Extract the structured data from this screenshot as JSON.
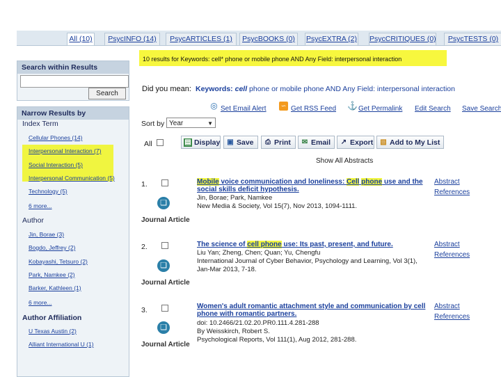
{
  "tabs": [
    {
      "label": "All (10)",
      "active": true
    },
    {
      "label": "PsycINFO (14)",
      "active": false
    },
    {
      "label": "PsycARTICLES (1)",
      "active": false
    },
    {
      "label": "PsycBOOKS (0)",
      "active": false
    },
    {
      "label": "PsycEXTRA (2)",
      "active": false
    },
    {
      "label": "PsycCRITIQUES (0)",
      "active": false
    },
    {
      "label": "PsycTESTS (0)",
      "active": false
    }
  ],
  "search_within": {
    "title": "Search within Results",
    "button": "Search",
    "value": ""
  },
  "narrow": {
    "title": "Narrow Results by",
    "index_term": {
      "title": "Index Term",
      "items": [
        "Cellular Phones (14)",
        "Interpersonal Interaction (7)",
        "Social Interaction (5)",
        "Interpersonal Communication (5)",
        "Technology (5)",
        "6 more..."
      ]
    },
    "author": {
      "title": "Author",
      "items": [
        "Jin, Borae (3)",
        "Bogdo, Jeffrey (2)",
        "Kobayashi, Tetsuro (2)",
        "Park, Namkee (2)",
        "Barker, Kathleen (1)",
        "6 more..."
      ]
    },
    "affiliation": {
      "title": "Author Affiliation",
      "items": [
        "U Texas Austin (2)",
        "Alliant International U (1)"
      ]
    }
  },
  "results_count": "10 results for Keywords: cell* phone or mobile phone AND Any Field: interpersonal interaction",
  "did_you_mean": {
    "label": "Did you mean:",
    "prefix": "Keywords: ",
    "keyword": "cell",
    "rest": " phone or mobile phone AND Any Field: interpersonal interaction"
  },
  "actions": [
    {
      "label": "Set Email Alert",
      "icon": "email-alert-icon"
    },
    {
      "label": "Get RSS Feed",
      "icon": "rss-icon"
    },
    {
      "label": "Get Permalink",
      "icon": "anchor-icon"
    },
    {
      "label": "Edit Search",
      "icon": ""
    },
    {
      "label": "Save Search",
      "icon": ""
    }
  ],
  "sort": {
    "label": "Sort by",
    "value": "Year"
  },
  "toolbar": {
    "all_label": "All",
    "buttons": [
      "Display",
      "Save",
      "Print",
      "Email",
      "Export",
      "Add to My List"
    ]
  },
  "show_all_abstracts": "Show All Abstracts",
  "results": [
    {
      "num": "1.",
      "title_parts": [
        "Mobile",
        " voice communication and loneliness: ",
        "Cell",
        " ",
        "phone",
        " use and the social skills deficit hypothesis."
      ],
      "authors": "Jin, Borae; Park, Namkee",
      "source": "New Media & Society, Vol 15(7), Nov 2013, 1094-1111.",
      "type": "Journal Article",
      "links": [
        "Abstract",
        "References"
      ]
    },
    {
      "num": "2.",
      "title_parts": [
        "The science of ",
        "cell phone",
        " use: Its past, present, and future."
      ],
      "authors": "Liu Yan; Zheng, Chen; Quan; Yu, Chengfu",
      "source": "International Journal of Cyber Behavior, Psychology and Learning, Vol 3(1),",
      "source2": "Jan-Mar 2013, 7-18.",
      "type": "Journal Article",
      "links": [
        "Abstract",
        "References"
      ]
    },
    {
      "num": "3.",
      "title": "Women's adult romantic attachment style and communication by cell phone with romantic partners.",
      "doi": "doi: 10.2466/21.02.20.PR0.111.4.281-288",
      "authors": "By Weisskirch, Robert S.",
      "source": "Psychological Reports, Vol 111(1), Aug 2012, 281-288.",
      "type": "Journal Article",
      "links": [
        "Abstract",
        "References"
      ]
    }
  ]
}
